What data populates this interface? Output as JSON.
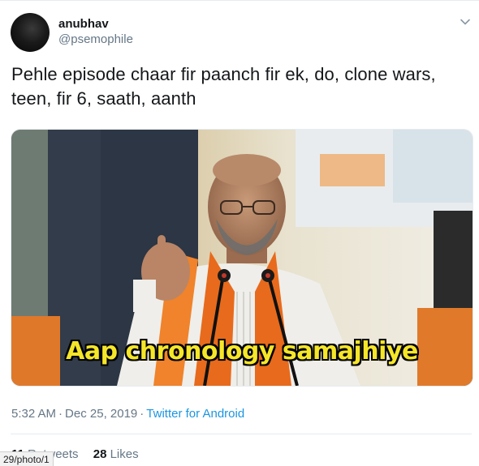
{
  "tweet": {
    "display_name": "anubhav",
    "handle": "@psemophile",
    "text": "Pehle episode chaar fir paanch fir ek, do, clone wars, teen, fir 6, saath, aanth",
    "media_caption": "Aap chronology samajhiye",
    "time": "5:32 AM",
    "separator": "·",
    "date": "Dec 25, 2019",
    "source": "Twitter for Android",
    "stats": {
      "retweets_count": "11",
      "retweets_label": "Retweets",
      "likes_count": "28",
      "likes_label": "Likes"
    }
  },
  "status_bar": {
    "url": "29/photo/1"
  },
  "icons": {
    "more": "chevron-down-icon"
  },
  "colors": {
    "primary_text": "#14171a",
    "secondary_text": "#657786",
    "link": "#1b95e0",
    "caption_yellow": "#f5e62a"
  }
}
